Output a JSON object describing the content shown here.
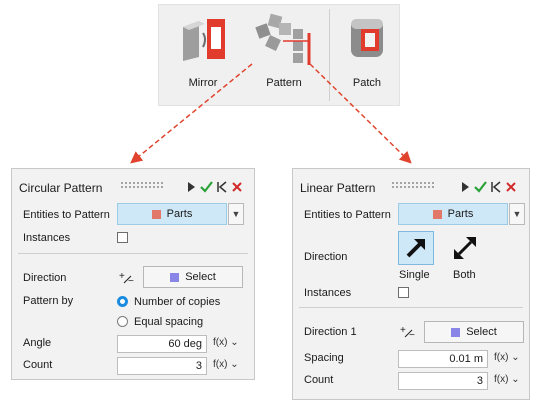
{
  "ribbon": {
    "mirror_label": "Mirror",
    "pattern_label": "Pattern",
    "patch_label": "Patch"
  },
  "circular": {
    "title": "Circular Pattern",
    "entities_label": "Entities to Pattern",
    "entities_value": "Parts",
    "instances_label": "Instances",
    "direction_label": "Direction",
    "direction_button": "Select",
    "pattern_by_label": "Pattern by",
    "option_number": "Number of copies",
    "option_equal": "Equal spacing",
    "angle_label": "Angle",
    "angle_value": "60 deg",
    "count_label": "Count",
    "count_value": "3",
    "fx": "f(x)"
  },
  "linear": {
    "title": "Linear Pattern",
    "entities_label": "Entities to Pattern",
    "entities_value": "Parts",
    "direction_label": "Direction",
    "single_label": "Single",
    "both_label": "Both",
    "instances_label": "Instances",
    "direction1_label": "Direction 1",
    "direction1_button": "Select",
    "spacing_label": "Spacing",
    "spacing_value": "0.01 m",
    "count_label": "Count",
    "count_value": "3",
    "fx": "f(x)"
  },
  "colors": {
    "accent_selected": "#cfe8f7",
    "arrow_red": "#e0442e",
    "check_green": "#2aa136",
    "close_red": "#d12a2a"
  }
}
